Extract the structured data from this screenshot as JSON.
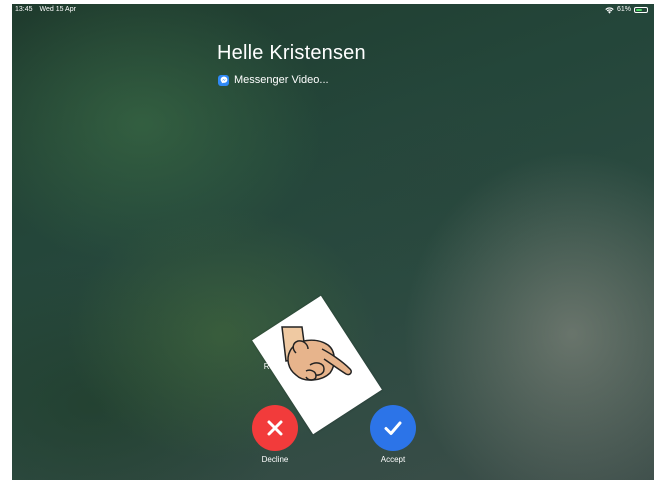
{
  "status_bar": {
    "time": "13:45",
    "date": "Wed 15 Apr",
    "battery_percent": "61%",
    "battery_level": 0.61,
    "wifi_icon": "wifi-icon",
    "battery_icon": "battery-icon"
  },
  "call": {
    "caller_name": "Helle Kristensen",
    "app_label": "Messenger Video...",
    "app_icon": "messenger-icon"
  },
  "actions": {
    "remind_label": "Remind M",
    "remind_icon": "alarm-clock-icon",
    "decline_label": "Decline",
    "decline_icon": "x-icon",
    "decline_color": "#f23b3b",
    "accept_label": "Accept",
    "accept_icon": "checkmark-icon",
    "accept_color": "#2c74e8"
  },
  "overlay": {
    "pointing_hand_icon": "pointing-hand-icon"
  }
}
